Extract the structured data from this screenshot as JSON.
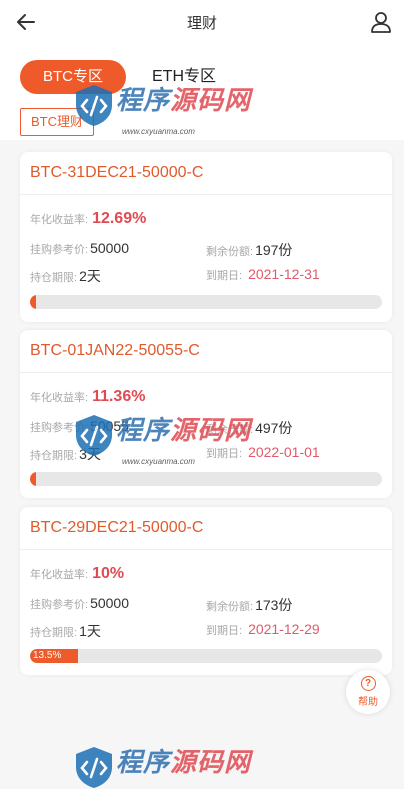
{
  "header": {
    "title": "理财"
  },
  "tabs": {
    "active": "BTC专区",
    "other": "ETH专区"
  },
  "subtab": {
    "label": "BTC理财"
  },
  "products": [
    {
      "name": "BTC-31DEC21-50000-C",
      "rate_label": "年化收益率:",
      "rate": "12.69%",
      "price_label": "挂购参考价:",
      "price": "50000",
      "remain_label": "剩余份额:",
      "remain": "197份",
      "period_label": "持仓期限:",
      "period": "2天",
      "expiry_label": "到期日:",
      "expiry": "2021-12-31",
      "progress": 0.015,
      "progress_text": ""
    },
    {
      "name": "BTC-01JAN22-50055-C",
      "rate_label": "年化收益率:",
      "rate": "11.36%",
      "price_label": "挂购参考价:",
      "price": "50055",
      "remain_label": "剩余份额:",
      "remain": "497份",
      "period_label": "持仓期限:",
      "period": "3天",
      "expiry_label": "到期日:",
      "expiry": "2022-01-01",
      "progress": 0.006,
      "progress_text": ""
    },
    {
      "name": "BTC-29DEC21-50000-C",
      "rate_label": "年化收益率:",
      "rate": "10%",
      "price_label": "挂购参考价:",
      "price": "50000",
      "remain_label": "剩余份额:",
      "remain": "173份",
      "period_label": "持仓期限:",
      "period": "1天",
      "expiry_label": "到期日:",
      "expiry": "2021-12-29",
      "progress": 0.135,
      "progress_text": "13.5%"
    }
  ],
  "help": {
    "label": "帮助"
  },
  "watermark": {
    "text_blue": "程序",
    "text_red": "源码网",
    "url": "www.cxyuanma.com"
  },
  "colors": {
    "accent": "#ef5a2a",
    "rate": "#e04a52",
    "date": "#e05a6a"
  }
}
